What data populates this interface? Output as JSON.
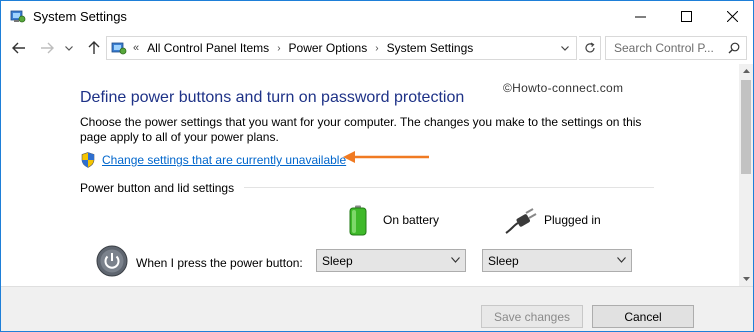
{
  "window": {
    "title": "System Settings",
    "app_icon": "control-panel-icon",
    "controls": [
      "minimize-icon",
      "maximize-icon",
      "close-icon"
    ]
  },
  "nav": {
    "back_icon": "back-arrow-icon",
    "forward_icon": "forward-arrow-icon",
    "recent_icon": "chevron-down-icon",
    "up_icon": "up-arrow-icon",
    "overflow": "«",
    "breadcrumbs": [
      "All Control Panel Items",
      "Power Options",
      "System Settings"
    ],
    "refresh_icon": "refresh-icon",
    "search_placeholder": "Search Control P..."
  },
  "content": {
    "watermark": "©Howto-connect.com",
    "heading": "Define power buttons and turn on password protection",
    "description": "Choose the power settings that you want for your computer. The changes you make to the settings on this page apply to all of your power plans.",
    "change_link": "Change settings that are currently unavailable",
    "section_title": "Power button and lid settings",
    "columns": {
      "on_battery": "On battery",
      "plugged_in": "Plugged in"
    },
    "rows": [
      {
        "label": "When I press the power button:",
        "on_battery_value": "Sleep",
        "plugged_in_value": "Sleep"
      }
    ]
  },
  "footer": {
    "save_label": "Save changes",
    "cancel_label": "Cancel"
  },
  "colors": {
    "heading": "#1e3287",
    "link": "#0066cc",
    "annotation_arrow": "#f07a22",
    "window_border": "#1e7fd8"
  }
}
